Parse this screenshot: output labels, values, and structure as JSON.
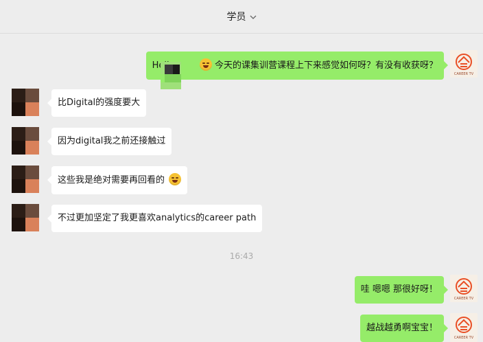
{
  "header": {
    "title": "学员"
  },
  "messages": [
    {
      "side": "out",
      "text_pre": "Hello",
      "text_post": "今天的课集训营课程上下来感觉如何呀？有没有收获呀？"
    },
    {
      "side": "in",
      "text": "比Digital的强度要大"
    },
    {
      "side": "in",
      "text": "因为digital我之前还接触过"
    },
    {
      "side": "in",
      "text": "这些我是绝对需要再回看的"
    },
    {
      "side": "in",
      "text": "不过更加坚定了我更喜欢analytics的career path"
    },
    {
      "side": "out",
      "text": "哇 嗯嗯 那很好呀！"
    },
    {
      "side": "out",
      "text": "越战越勇啊宝宝！"
    }
  ],
  "timestamp": "16:43",
  "avatar_right": {
    "logo_text": "CAREER TV"
  },
  "colors": {
    "background": "#ededed",
    "outgoing_bubble": "#95ec69",
    "incoming_bubble": "#ffffff",
    "brand": "#e94e24"
  },
  "icons": {
    "dropdown": "chevron-down-icon",
    "emoji": "grinning-emoji-icon"
  }
}
